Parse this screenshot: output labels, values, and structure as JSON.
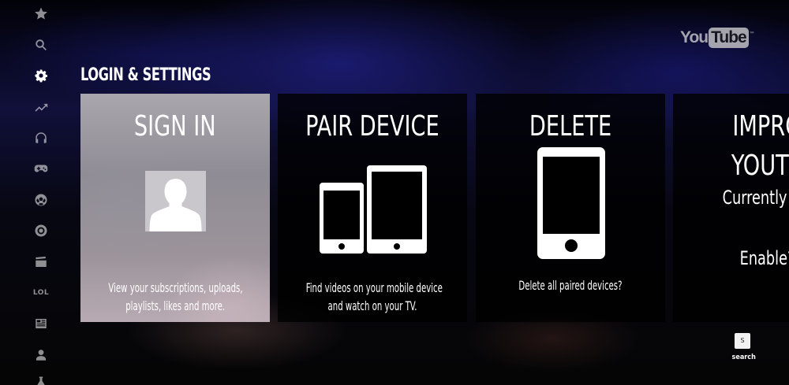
{
  "sidebar": {
    "items": [
      {
        "icon": "star-icon",
        "label": ""
      },
      {
        "icon": "search-icon",
        "label": ""
      },
      {
        "icon": "gear-icon",
        "label": "",
        "active": true
      },
      {
        "icon": "trending-icon",
        "label": ""
      },
      {
        "icon": "headphones-icon",
        "label": ""
      },
      {
        "icon": "gamepad-icon",
        "label": ""
      },
      {
        "icon": "soccer-ball-icon",
        "label": ""
      },
      {
        "icon": "camera-aperture-icon",
        "label": ""
      },
      {
        "icon": "clapperboard-icon",
        "label": ""
      },
      {
        "icon": "lol-icon",
        "label": "LOL"
      },
      {
        "icon": "news-icon",
        "label": ""
      },
      {
        "icon": "user-icon",
        "label": ""
      },
      {
        "icon": "flask-icon",
        "label": ""
      }
    ]
  },
  "logo": {
    "you": "You",
    "tube": "Tube",
    "tm": "™"
  },
  "section": {
    "title": "LOGIN & SETTINGS"
  },
  "cards": {
    "sign_in": {
      "title": "SIGN IN",
      "desc_line1": "View your subscriptions, uploads,",
      "desc_line2": "playlists, likes and more.",
      "icon": "user-silhouette-icon"
    },
    "pair_device": {
      "title": "PAIR DEVICE",
      "desc_line1": "Find videos on your mobile device",
      "desc_line2": "and watch on your TV.",
      "icon": "devices-icon"
    },
    "delete": {
      "title": "DELETE",
      "desc_line1": "Delete all paired devices?",
      "icon": "phone-icon"
    },
    "improve": {
      "title_line1": "IMPRO",
      "title_line2": "YOUTU",
      "status": "Currently Dis",
      "action": "Enable?"
    }
  },
  "search_hint": {
    "key": "S",
    "label": "search"
  },
  "colors": {
    "accent_blue": "#1c1c8c",
    "card_bg": "#000000",
    "selected_card": "#a9a6ad",
    "text": "#ffffff"
  }
}
